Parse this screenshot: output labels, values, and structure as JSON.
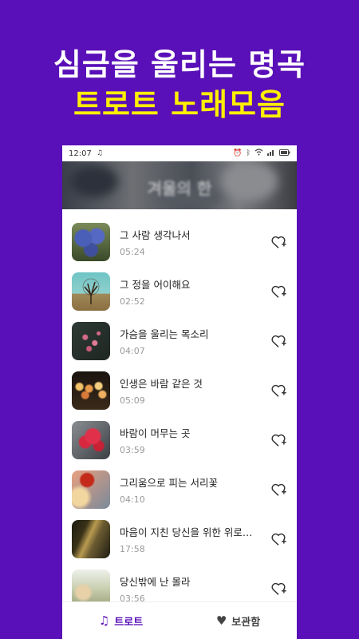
{
  "headline": {
    "line1": "심금을 울리는 명곡",
    "line2": "트로트 노래모음"
  },
  "status": {
    "time": "12:07"
  },
  "banner": {
    "text": "겨울의 한"
  },
  "songs": [
    {
      "title": "그 사람 생각나서",
      "duration": "05:24"
    },
    {
      "title": "그 정을 어이해요",
      "duration": "02:52"
    },
    {
      "title": "가슴을 울리는 목소리",
      "duration": "04:07"
    },
    {
      "title": "인생은 바람 같은 것",
      "duration": "05:09"
    },
    {
      "title": "바람이 머무는 곳",
      "duration": "03:59"
    },
    {
      "title": "그리움으로 피는 서리꽃",
      "duration": "04:10"
    },
    {
      "title": "마음이 지친 당신을 위한 위로…",
      "duration": "17:58"
    },
    {
      "title": "당신밖에 난 몰라",
      "duration": "03:56"
    }
  ],
  "nav": {
    "trot": "트로트",
    "storage": "보관함"
  },
  "colors": {
    "brand": "#5a10b8",
    "accent": "#ffef00"
  }
}
